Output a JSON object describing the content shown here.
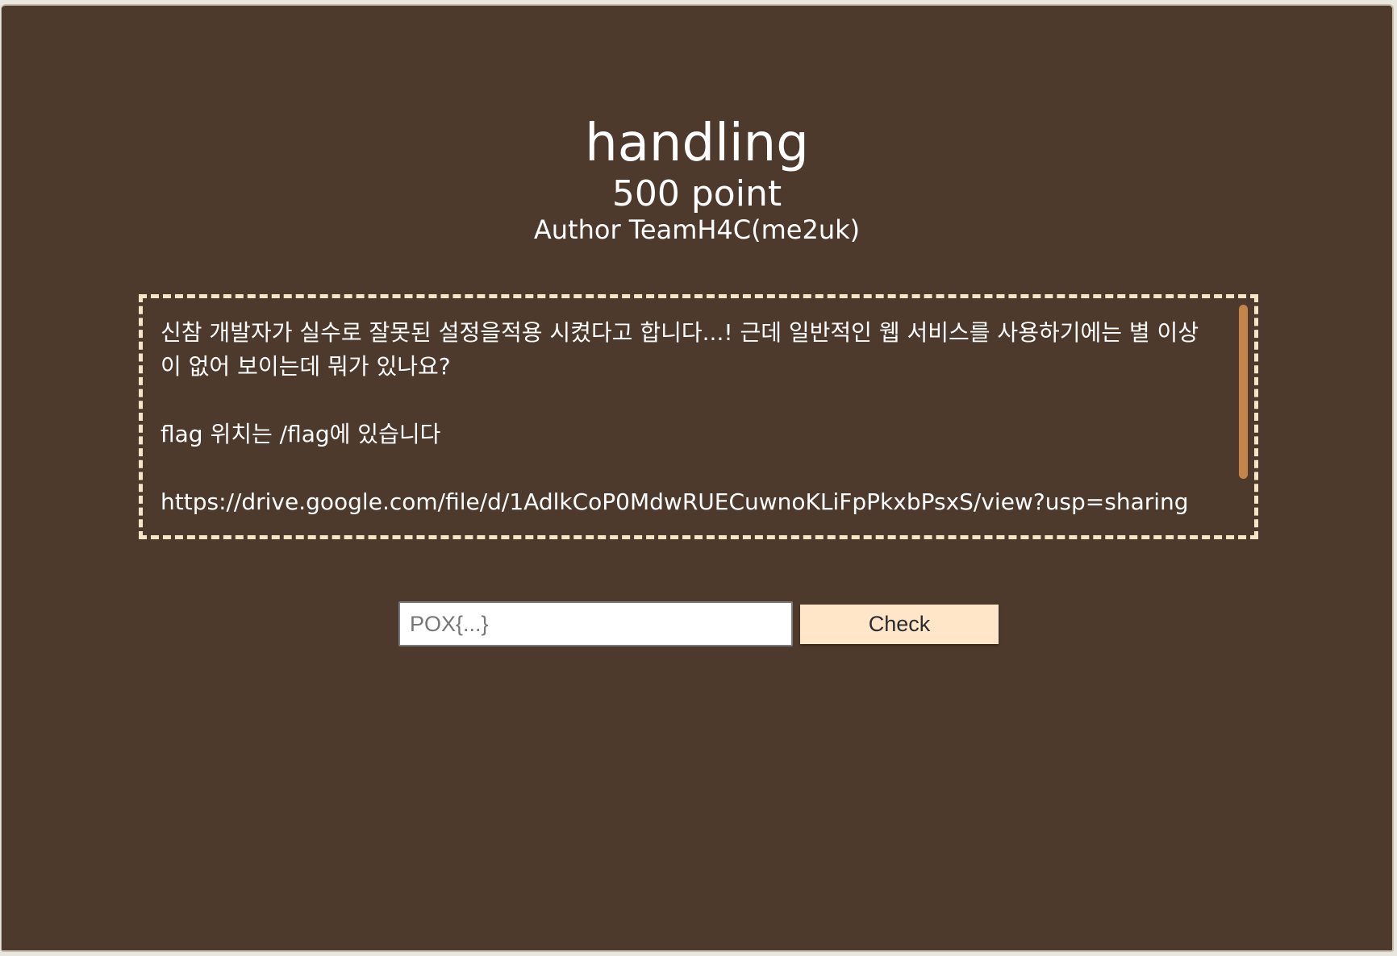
{
  "challenge": {
    "title": "handling",
    "points": "500 point",
    "author": "Author TeamH4C(me2uk)"
  },
  "description": {
    "paragraphs": [
      "신참 개발자가 실수로 잘못된 설정을적용 시켰다고 합니다...! 근데 일반적인 웹 서비스를 사용하기에는 별 이상이 없어 보이는데 뭐가 있나요?",
      "flag 위치는 /flag에 있습니다",
      "https://drive.google.com/file/d/1AdlkCoP0MdwRUECuwnoKLiFpPkxbPsxS/view?usp=sharing"
    ]
  },
  "submit": {
    "placeholder": "POX{...}",
    "button_label": "Check"
  },
  "colors": {
    "background": "#4e3a2c",
    "border_dashed": "#f8e4c6",
    "button": "#ffe6c9",
    "scrollbar": "#c4854a"
  }
}
